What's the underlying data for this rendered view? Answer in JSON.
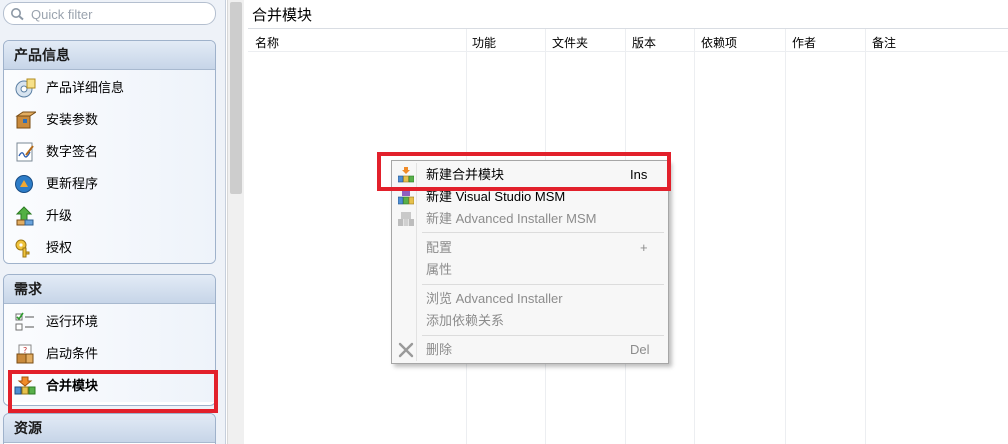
{
  "filter": {
    "placeholder": "Quick filter"
  },
  "sidebar": {
    "groups": [
      {
        "title": "产品信息",
        "items": [
          {
            "label": "产品详细信息",
            "icon": "product-details-icon"
          },
          {
            "label": "安装参数",
            "icon": "install-parameters-icon"
          },
          {
            "label": "数字签名",
            "icon": "digital-signature-icon"
          },
          {
            "label": "更新程序",
            "icon": "updater-icon"
          },
          {
            "label": "升级",
            "icon": "upgrade-icon"
          },
          {
            "label": "授权",
            "icon": "licensing-icon"
          }
        ]
      },
      {
        "title": "需求",
        "items": [
          {
            "label": "运行环境",
            "icon": "prerequisites-icon"
          },
          {
            "label": "启动条件",
            "icon": "launch-conditions-icon"
          },
          {
            "label": "合并模块",
            "icon": "merge-modules-icon",
            "selected": true
          }
        ]
      },
      {
        "title": "资源",
        "items": []
      }
    ]
  },
  "main": {
    "title": "合并模块",
    "columns": [
      "名称",
      "功能",
      "文件夹",
      "版本",
      "依赖项",
      "作者",
      "备注"
    ]
  },
  "context_menu": {
    "items": [
      {
        "label": "新建合并模块",
        "shortcut": "Ins",
        "enabled": true,
        "icon": "new-merge-module-icon"
      },
      {
        "label": "新建 Visual Studio MSM",
        "shortcut": "",
        "enabled": true,
        "icon": "new-vs-msm-icon"
      },
      {
        "label": "新建 Advanced Installer MSM",
        "shortcut": "",
        "enabled": false,
        "icon": "new-ai-msm-icon"
      },
      {
        "label": "配置",
        "shortcut": "+",
        "enabled": false
      },
      {
        "label": "属性",
        "shortcut": "",
        "enabled": false
      },
      {
        "label": "浏览 Advanced Installer",
        "shortcut": "",
        "enabled": false
      },
      {
        "label": "添加依赖关系",
        "shortcut": "",
        "enabled": false
      },
      {
        "label": "删除",
        "shortcut": "Del",
        "enabled": false,
        "icon": "delete-icon"
      }
    ]
  },
  "colors": {
    "highlight": "#e2202b",
    "group_header": "#c7d5e8",
    "sidebar_bg": "#eef2f8"
  }
}
